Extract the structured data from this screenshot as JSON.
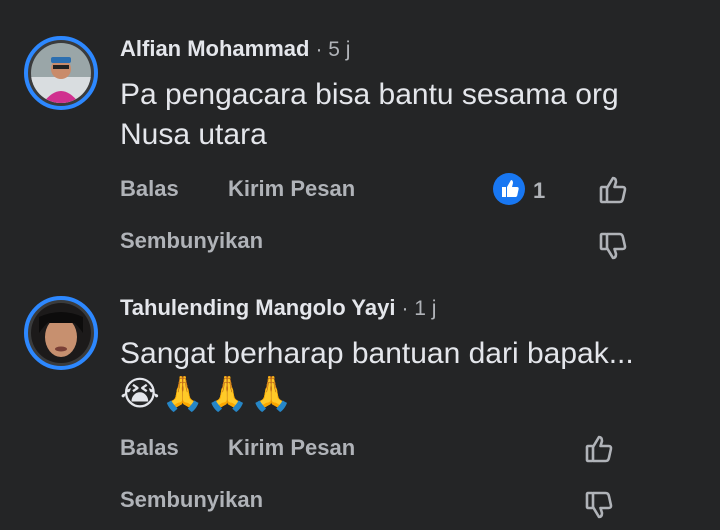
{
  "comments": [
    {
      "author": "Alfian Mohammad",
      "time": "· 5 j",
      "text": "Pa pengacara bisa bantu sesama org Nusa utara",
      "reply_label": "Balas",
      "message_label": "Kirim Pesan",
      "hide_label": "Sembunyikan",
      "like_count": "1"
    },
    {
      "author": "Tahulending Mangolo Yayi",
      "time": "· 1 j",
      "text": "Sangat berharap bantuan dari bapak...",
      "emojis": "😭🙏🙏🙏",
      "reply_label": "Balas",
      "message_label": "Kirim Pesan",
      "hide_label": "Sembunyikan"
    }
  ],
  "colors": {
    "background": "#242526",
    "primary_text": "#e4e6eb",
    "secondary_text": "#b0b3b8",
    "accent_blue": "#1877f2",
    "avatar_ring": "#2d88ff"
  }
}
